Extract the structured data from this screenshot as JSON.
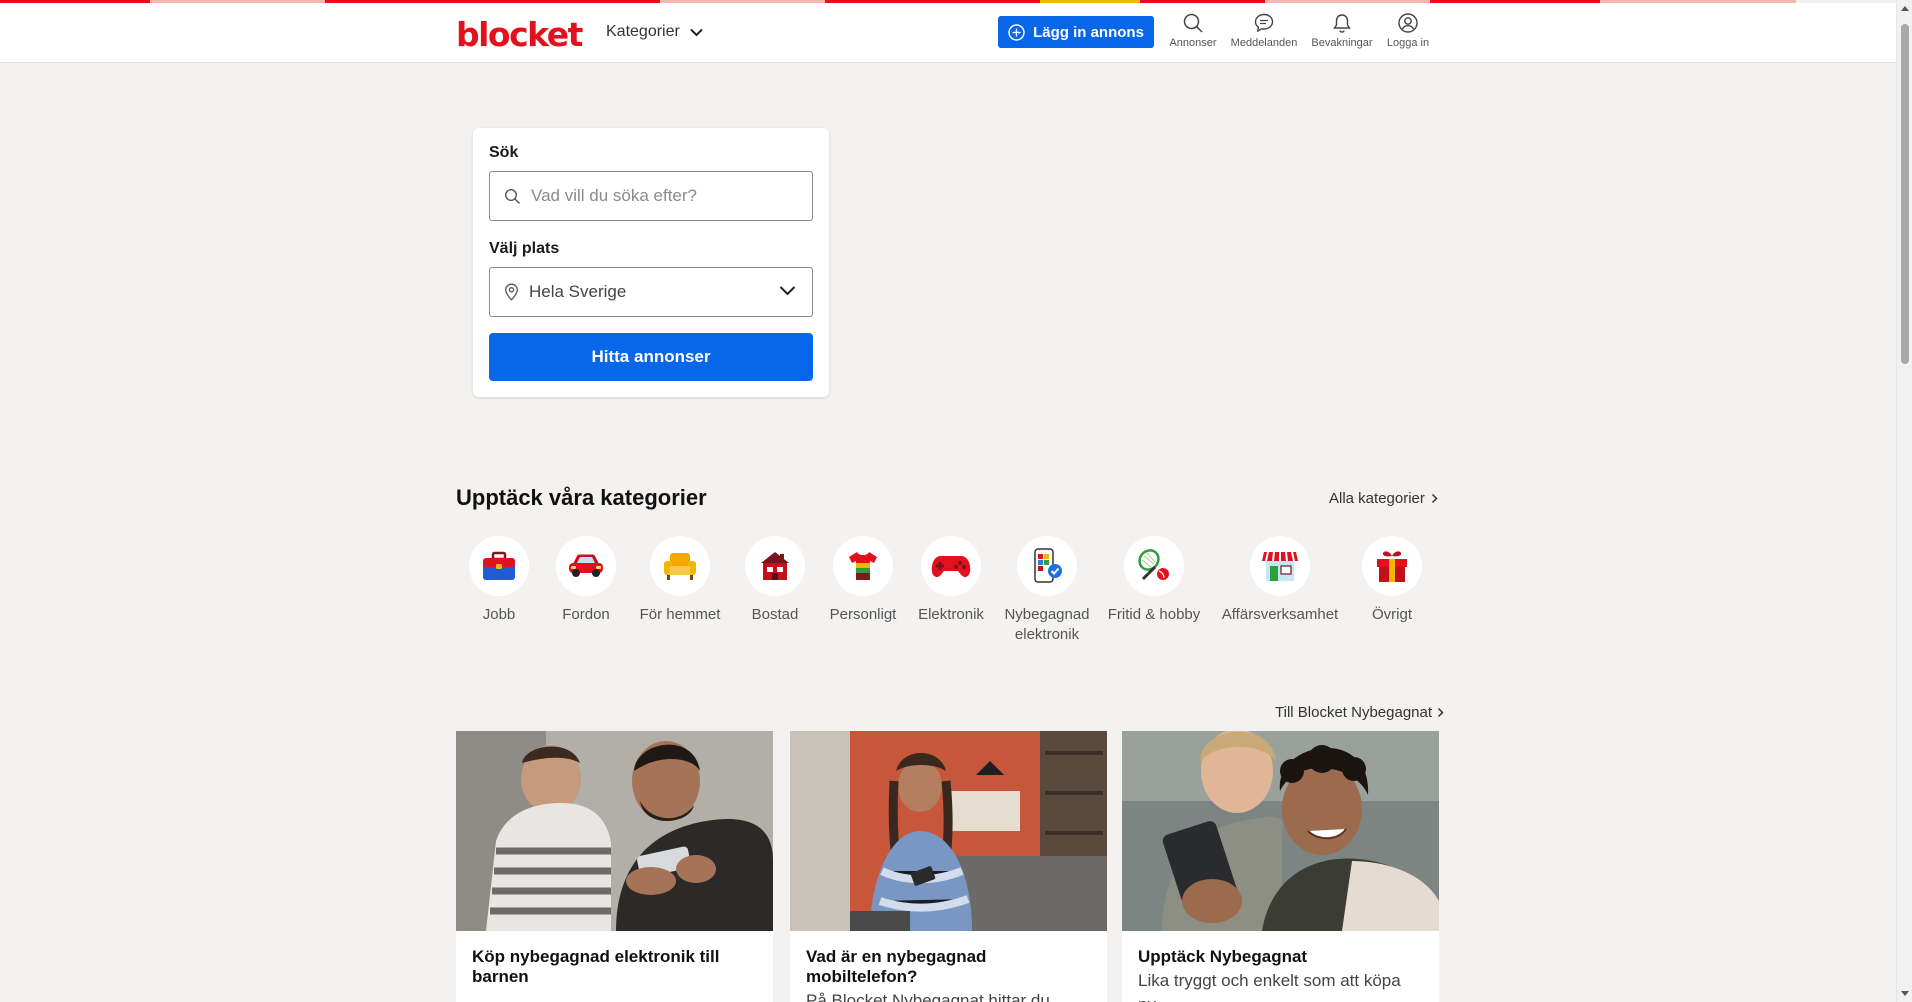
{
  "colors": {
    "brand_red": "#e3101e",
    "primary_blue": "#0866e8",
    "page_bg": "#f3f2f0"
  },
  "header": {
    "logo": "blocket",
    "categories_menu": "Kategorier",
    "post_ad_button": "Lägg in annons",
    "nav": [
      {
        "label": "Annonser",
        "icon": "search-icon"
      },
      {
        "label": "Meddelanden",
        "icon": "chat-icon"
      },
      {
        "label": "Bevakningar",
        "icon": "bell-icon"
      },
      {
        "label": "Logga in",
        "icon": "user-icon"
      }
    ]
  },
  "search": {
    "search_label": "Sök",
    "search_placeholder": "Vad vill du söka efter?",
    "location_label": "Välj plats",
    "location_value": "Hela Sverige",
    "submit_button": "Hitta annonser"
  },
  "categories": {
    "title": "Upptäck våra kategorier",
    "all_link": "Alla kategorier",
    "items": [
      {
        "label": "Jobb",
        "icon": "briefcase-icon"
      },
      {
        "label": "Fordon",
        "icon": "car-icon"
      },
      {
        "label": "För hemmet",
        "icon": "armchair-icon"
      },
      {
        "label": "Bostad",
        "icon": "house-icon"
      },
      {
        "label": "Personligt",
        "icon": "shirt-icon"
      },
      {
        "label": "Elektronik",
        "icon": "gamepad-icon"
      },
      {
        "label": "Nybegagnad elektronik",
        "icon": "phone-verified-icon"
      },
      {
        "label": "Fritid & hobby",
        "icon": "tennis-icon"
      },
      {
        "label": "Affärsverksamhet",
        "icon": "shop-icon"
      },
      {
        "label": "Övrigt",
        "icon": "gift-icon"
      }
    ]
  },
  "nybegagnat": {
    "link": "Till Blocket Nybegagnat",
    "cards": [
      {
        "title": "Köp nybegagnad elektronik till barnen",
        "text": ""
      },
      {
        "title": "Vad är en nybegagnad mobiltelefon?",
        "text": "På Blocket Nybegagnat hittar du"
      },
      {
        "title": "Upptäck Nybegagnat",
        "text": "Lika tryggt och enkelt som att köpa ny,"
      }
    ]
  }
}
